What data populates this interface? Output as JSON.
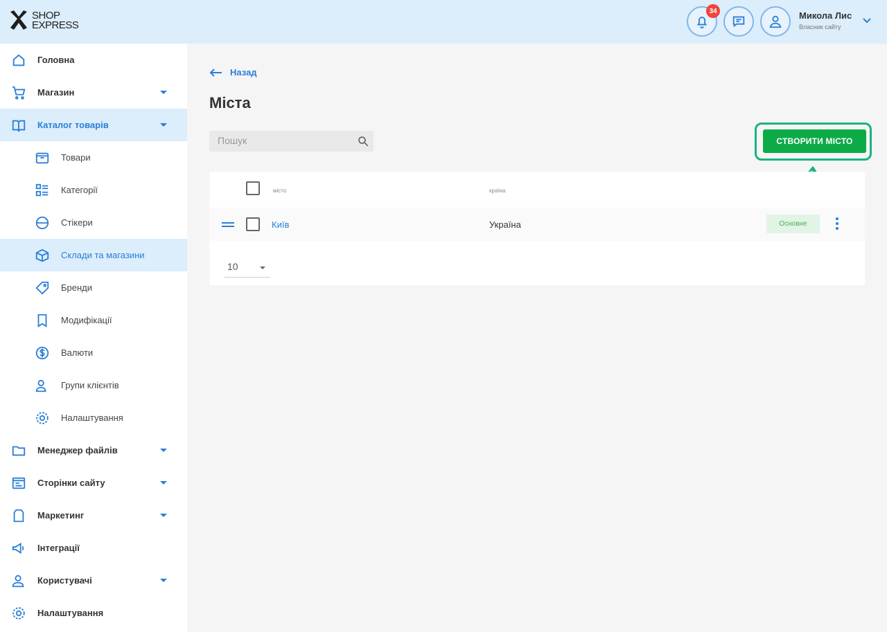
{
  "header": {
    "logo_line1": "SHOP",
    "logo_line2": "EXPRESS",
    "notifications_count": "34",
    "user_name": "Микола Лис",
    "user_role": "Власник сайту"
  },
  "sidebar": {
    "items": [
      {
        "label": "Головна",
        "icon": "home-icon"
      },
      {
        "label": "Магазин",
        "icon": "cart-icon",
        "expandable": true
      },
      {
        "label": "Каталог товарів",
        "icon": "catalog-icon",
        "expandable": true,
        "active": true
      },
      {
        "label": "Товари",
        "icon": "product-box-icon"
      },
      {
        "label": "Категорії",
        "icon": "categories-icon"
      },
      {
        "label": "Стікери",
        "icon": "sticker-icon"
      },
      {
        "label": "Склади та магазини",
        "icon": "warehouse-icon",
        "active": true
      },
      {
        "label": "Бренди",
        "icon": "tag-icon"
      },
      {
        "label": "Модифікації",
        "icon": "bookmark-icon"
      },
      {
        "label": "Валюти",
        "icon": "dollar-icon"
      },
      {
        "label": "Групи клієнтів",
        "icon": "user-group-icon"
      },
      {
        "label": "Налаштування",
        "icon": "gear-icon"
      },
      {
        "label": "Менеджер файлів",
        "icon": "folder-icon",
        "expandable": true
      },
      {
        "label": "Сторінки сайту",
        "icon": "pages-icon",
        "expandable": true
      },
      {
        "label": "Маркетинг",
        "icon": "marketing-icon",
        "expandable": true
      },
      {
        "label": "Інтеграції",
        "icon": "megaphone-icon"
      },
      {
        "label": "Користувачі",
        "icon": "users-icon",
        "expandable": true
      },
      {
        "label": "Налаштування",
        "icon": "gear-icon"
      }
    ]
  },
  "main": {
    "back_label": "Назад",
    "title": "Міста",
    "search_placeholder": "Пошук",
    "create_button": "СТВОРИТИ МІСТО",
    "table": {
      "columns": [
        "місто",
        "країна"
      ],
      "rows": [
        {
          "city": "Київ",
          "country": "Україна",
          "status": "Основне"
        }
      ]
    },
    "per_page": "10"
  },
  "colors": {
    "accent": "#2a7fd6",
    "header_bg": "#dcedfb",
    "create_button": "#0dab47",
    "highlight_frame": "#17b383",
    "badge": "#f0443c"
  }
}
